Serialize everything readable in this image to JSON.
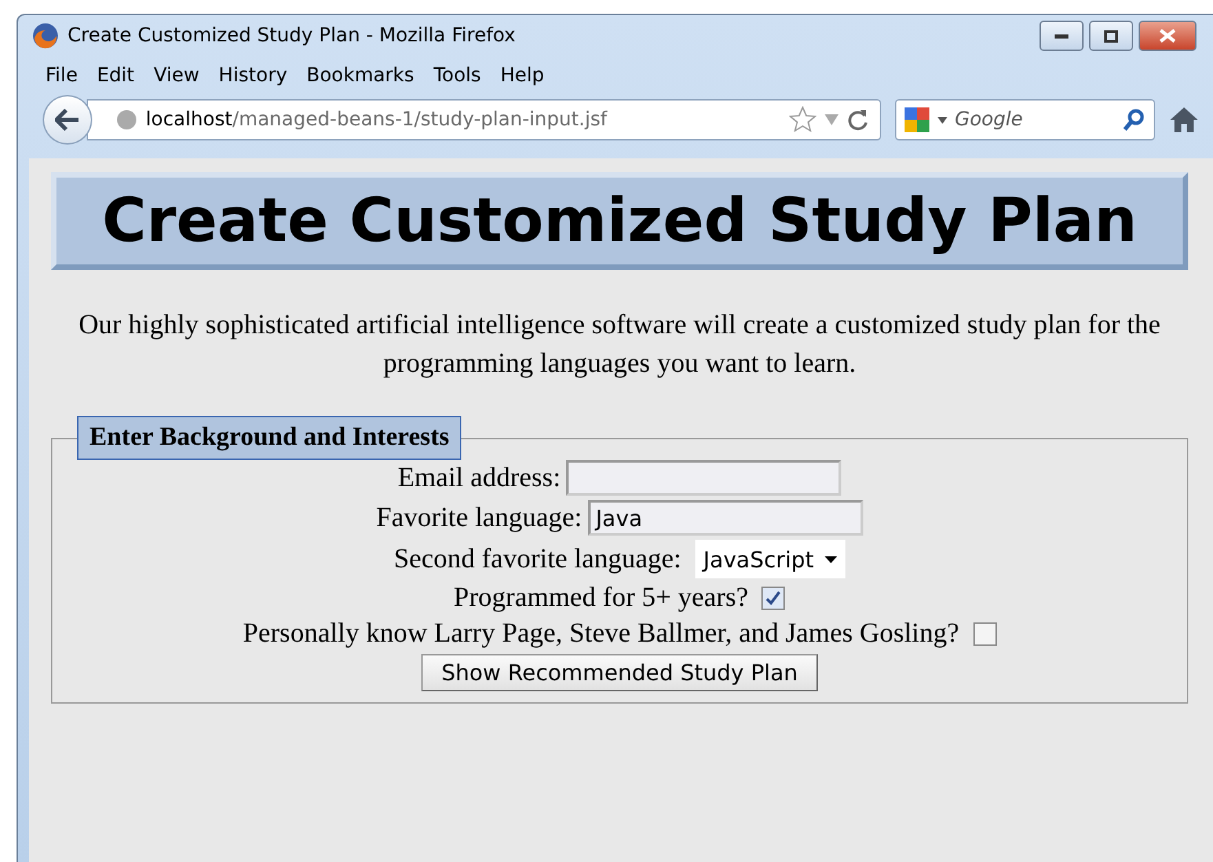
{
  "window": {
    "title": "Create Customized Study Plan - Mozilla Firefox"
  },
  "menu": [
    "File",
    "Edit",
    "View",
    "History",
    "Bookmarks",
    "Tools",
    "Help"
  ],
  "address_bar": {
    "host": "localhost",
    "path": "/managed-beans-1/study-plan-input.jsf"
  },
  "search": {
    "placeholder": "Google"
  },
  "page": {
    "heading": "Create Customized Study Plan",
    "intro": "Our highly sophisticated artificial intelligence software will create a customized study plan for the programming languages you want to learn.",
    "fieldset": {
      "legend": "Enter Background and Interests",
      "rows": [
        {
          "kind": "text",
          "label": "Email address:",
          "value": ""
        },
        {
          "kind": "text",
          "label": "Favorite language:",
          "value": "Java"
        },
        {
          "kind": "select",
          "label": "Second favorite language:",
          "value": "JavaScript"
        },
        {
          "kind": "checkbox",
          "label": "Programmed for 5+ years?",
          "checked": true
        },
        {
          "kind": "checkbox",
          "label": "Personally know Larry Page, Steve Ballmer, and James Gosling?",
          "checked": false
        },
        {
          "kind": "button",
          "label": "Show Recommended Study Plan"
        }
      ]
    }
  }
}
